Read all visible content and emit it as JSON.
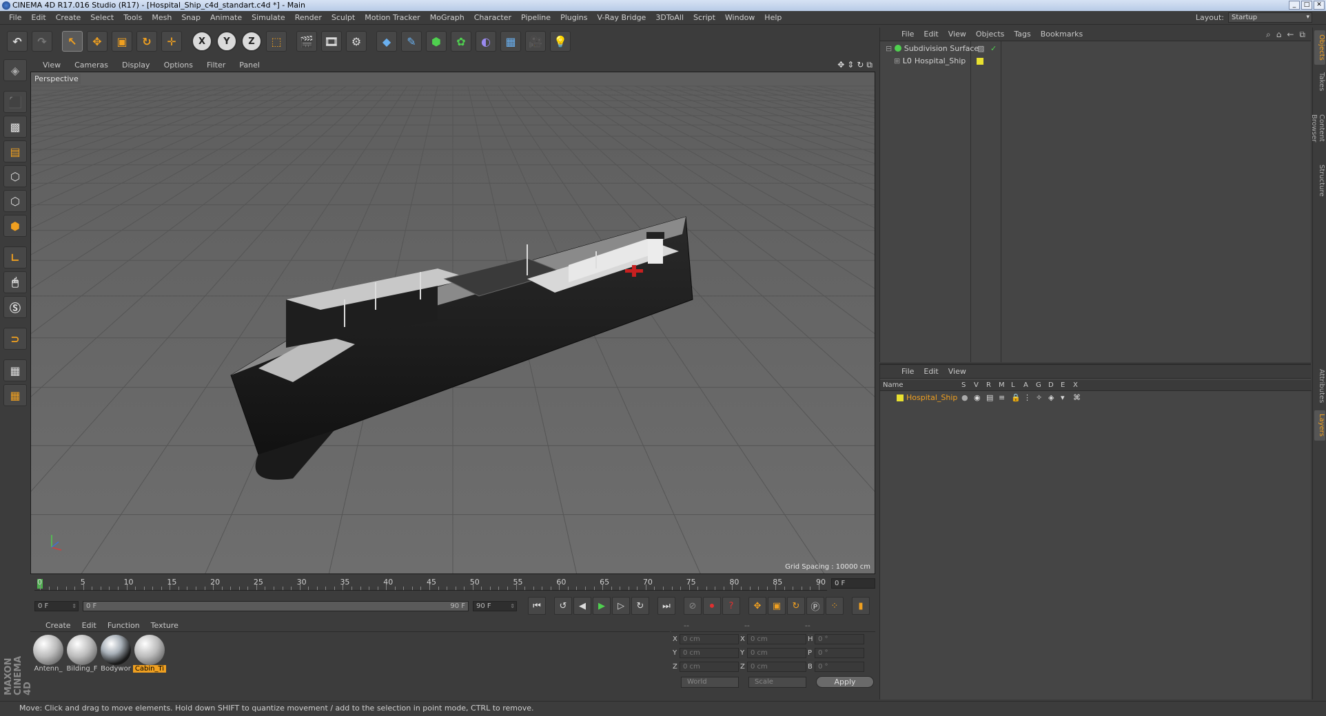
{
  "window": {
    "title": "CINEMA 4D R17.016 Studio (R17) - [Hospital_Ship_c4d_standart.c4d *] - Main"
  },
  "menubar": [
    "File",
    "Edit",
    "Create",
    "Select",
    "Tools",
    "Mesh",
    "Snap",
    "Animate",
    "Simulate",
    "Render",
    "Sculpt",
    "Motion Tracker",
    "MoGraph",
    "Character",
    "Pipeline",
    "Plugins",
    "V-Ray Bridge",
    "3DToAll",
    "Script",
    "Window",
    "Help"
  ],
  "layout": {
    "label": "Layout:",
    "value": "Startup"
  },
  "viewport": {
    "menu": [
      "View",
      "Cameras",
      "Display",
      "Options",
      "Filter",
      "Panel"
    ],
    "label": "Perspective",
    "grid_spacing": "Grid Spacing : 10000 cm"
  },
  "timeline": {
    "ticks": [
      "0",
      "5",
      "10",
      "15",
      "20",
      "25",
      "30",
      "35",
      "40",
      "45",
      "50",
      "55",
      "60",
      "65",
      "70",
      "75",
      "80",
      "85",
      "90"
    ],
    "current_frame_right": "0 F",
    "start_field": "0 F",
    "range_start": "0 F",
    "range_end": "90 F",
    "end_field": "90 F"
  },
  "material_panel": {
    "menu": [
      "Create",
      "Edit",
      "Function",
      "Texture"
    ],
    "materials": [
      {
        "name": "Antenn_",
        "selected": false
      },
      {
        "name": "Bilding_F",
        "selected": false
      },
      {
        "name": "Bodywor",
        "selected": false
      },
      {
        "name": "Cabin_Ti",
        "selected": true
      }
    ]
  },
  "coordinates": {
    "headers": [
      "--",
      "--",
      "--"
    ],
    "rows": [
      {
        "a1": "X",
        "v1": "0 cm",
        "a2": "X",
        "v2": "0 cm",
        "a3": "H",
        "v3": "0 °"
      },
      {
        "a1": "Y",
        "v1": "0 cm",
        "a2": "Y",
        "v2": "0 cm",
        "a3": "P",
        "v3": "0 °"
      },
      {
        "a1": "Z",
        "v1": "0 cm",
        "a2": "Z",
        "v2": "0 cm",
        "a3": "B",
        "v3": "0 °"
      }
    ],
    "mode": "World",
    "type": "Scale",
    "apply": "Apply"
  },
  "object_manager": {
    "menu": [
      "File",
      "Edit",
      "View",
      "Objects",
      "Tags",
      "Bookmarks"
    ],
    "objects": [
      {
        "name": "Subdivision Surface"
      },
      {
        "name": "Hospital_Ship"
      }
    ]
  },
  "layer_manager": {
    "menu": [
      "File",
      "Edit",
      "View"
    ],
    "columns": [
      "Name",
      "S",
      "V",
      "R",
      "M",
      "L",
      "A",
      "G",
      "D",
      "E",
      "X"
    ],
    "layer_name": "Hospital_Ship"
  },
  "right_tabs": [
    "Objects",
    "Takes",
    "Content Browser",
    "Structure",
    "Attributes",
    "Layers"
  ],
  "status": "Move: Click and drag to move elements. Hold down SHIFT to quantize movement / add to the selection in point mode, CTRL to remove.",
  "brand": "MAXON CINEMA 4D",
  "colors": {
    "accent": "#f0a020",
    "layer": "#e8e030"
  }
}
